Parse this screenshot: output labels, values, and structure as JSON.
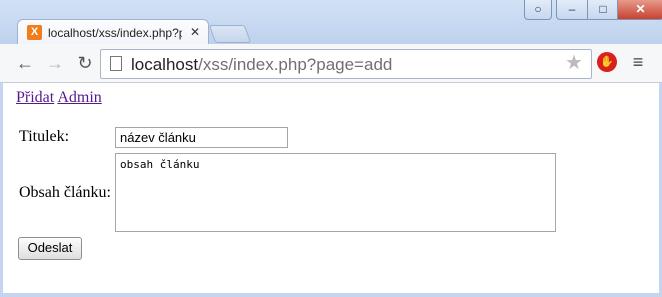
{
  "window": {
    "tab_title": "localhost/xss/index.php?p",
    "favicon_letter": "X",
    "controls": {
      "user": "○",
      "minimize": "–",
      "maximize": "□",
      "close": "✕"
    },
    "colors": {
      "tab_favicon": "#f27b1b",
      "close_button": "#c7422f",
      "ext_icon": "#d9201b"
    }
  },
  "toolbar": {
    "back": "←",
    "forward": "→",
    "reload": "↻",
    "url_host": "localhost",
    "url_path": "/xss/index.php?page=add",
    "star": "★",
    "menu": "≡",
    "icons": [
      "back-arrow-icon",
      "forward-arrow-icon",
      "reload-icon",
      "page-icon",
      "bookmark-star-icon",
      "stop-extension-icon",
      "hamburger-menu-icon"
    ]
  },
  "page": {
    "nav": [
      {
        "label": "Přidat"
      },
      {
        "label": "Admin"
      }
    ],
    "form": {
      "title_label": "Titulek:",
      "title_value": "název článku",
      "content_label": "Obsah článku:",
      "content_value": "obsah článku",
      "submit_label": "Odeslat"
    }
  }
}
